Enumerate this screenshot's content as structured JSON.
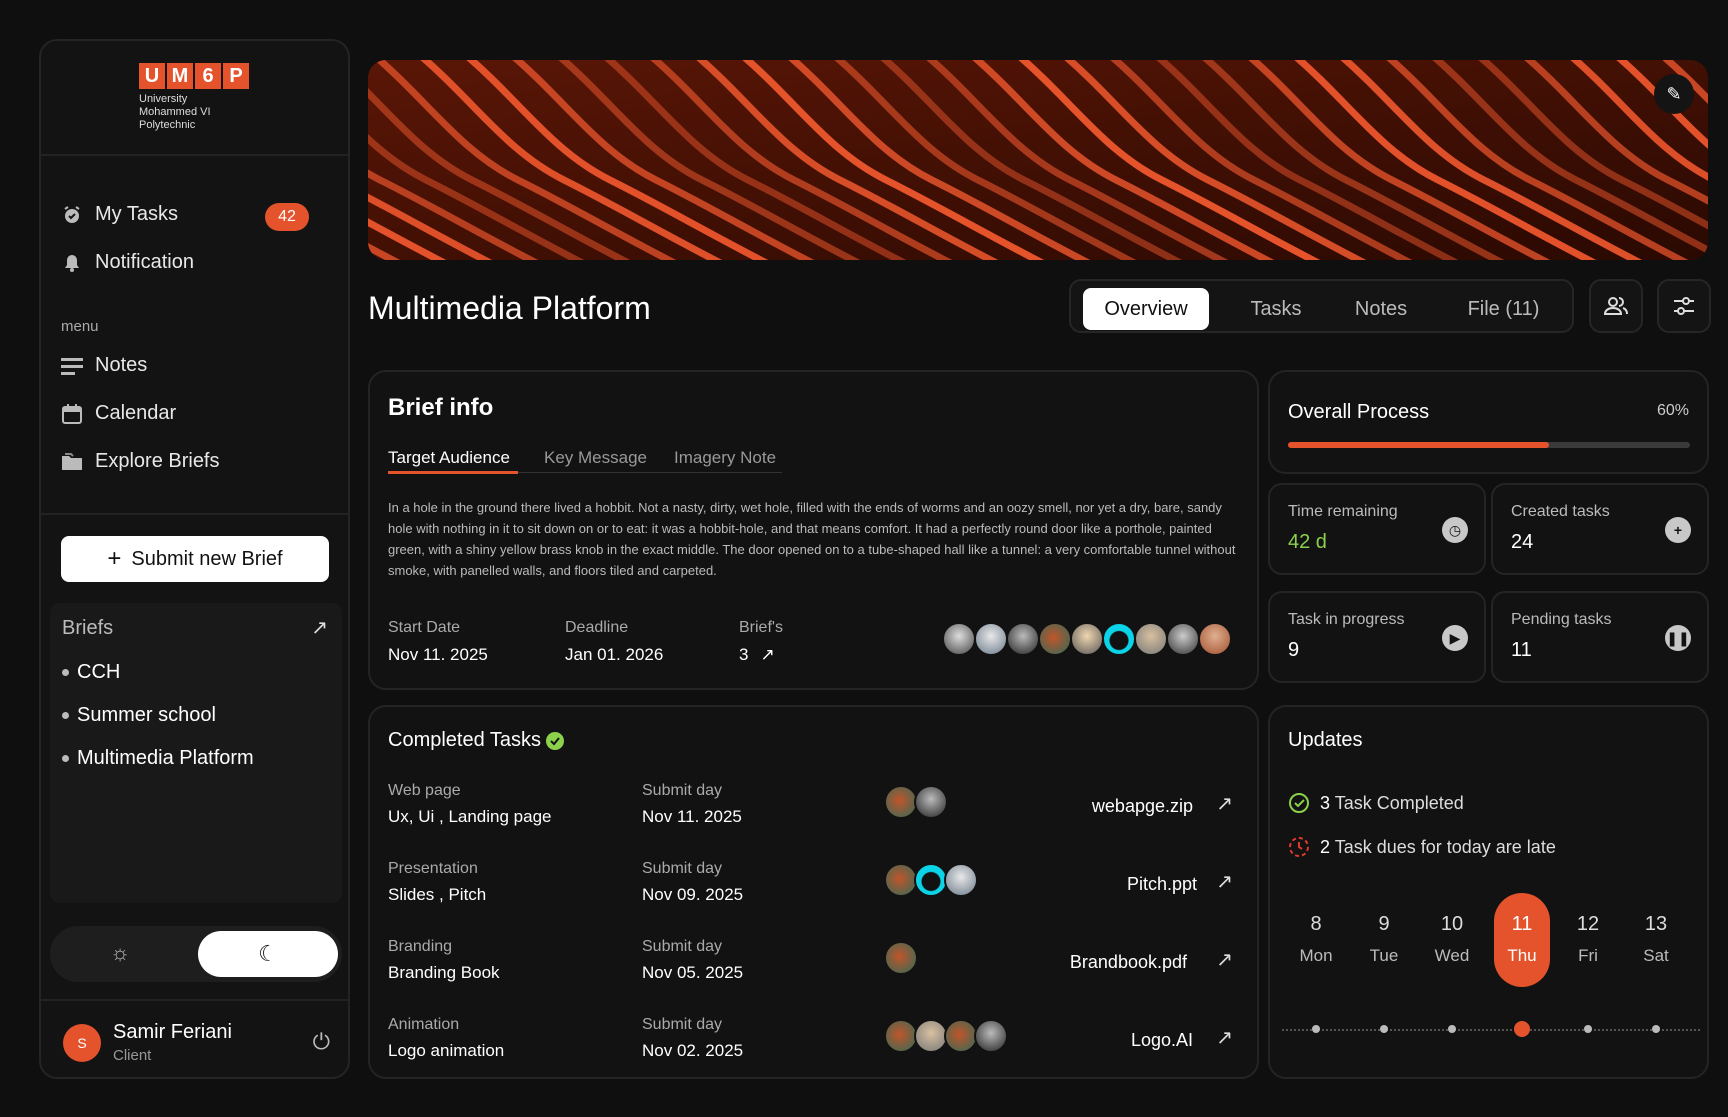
{
  "logo": {
    "letters": [
      "U",
      "M",
      "6",
      "P"
    ],
    "line1": "University",
    "line2": "Mohammed VI",
    "line3": "Polytechnic"
  },
  "sidebar": {
    "my_tasks": "My Tasks",
    "my_tasks_count": "42",
    "notification": "Notification",
    "menu_label": "menu",
    "notes": "Notes",
    "calendar": "Calendar",
    "explore_briefs": "Explore Briefs",
    "submit_btn": "Submit new Brief",
    "briefs_title": "Briefs",
    "briefs": [
      "CCH",
      "Summer school",
      "Multimedia Platform"
    ]
  },
  "user": {
    "initial": "S",
    "name": "Samir Feriani",
    "role": "Client"
  },
  "page": {
    "title": "Multimedia Platform"
  },
  "tabs": [
    "Overview",
    "Tasks",
    "Notes",
    "File (11)"
  ],
  "brief_info": {
    "title": "Brief info",
    "subtabs": [
      "Target Audience",
      "Key Message",
      "Imagery Note"
    ],
    "text": "In a hole in the ground there lived a hobbit. Not a nasty, dirty, wet hole, filled with the  ends of worms and an oozy smell, nor yet a dry, bare, sandy hole with nothing in it to sit down on  or to eat: it was a hobbit-hole, and that means comfort. It had a perfectly round door like a porthole, painted green, with a shiny yellow brass  knob in the exact middle. The door opened on to a tube-shaped hall like a tunnel: a very  comfortable tunnel without smoke, with panelled walls, and floors tiled and carpeted.",
    "start_label": "Start Date",
    "start_value": "Nov 11. 2025",
    "deadline_label": "Deadline",
    "deadline_value": "Jan 01. 2026",
    "briefs_label": "Brief's",
    "briefs_value": "3"
  },
  "overall": {
    "title": "Overall Process",
    "percent_label": "60%",
    "progress": 0.65
  },
  "stats": {
    "time_remaining_label": "Time remaining",
    "time_remaining_value": "42 d",
    "created_label": "Created tasks",
    "created_value": "24",
    "progress_label": "Task in progress",
    "progress_value": "9",
    "pending_label": "Pending tasks",
    "pending_value": "11"
  },
  "completed": {
    "title": "Completed Tasks",
    "submit_label": "Submit day",
    "rows": [
      {
        "category": "Web page",
        "name": "Ux, Ui , Landing page",
        "date": "Nov 11. 2025",
        "file": "webapge.zip"
      },
      {
        "category": "Presentation",
        "name": "Slides , Pitch",
        "date": "Nov 09. 2025",
        "file": "Pitch.ppt"
      },
      {
        "category": "Branding",
        "name": "Branding Book",
        "date": "Nov 05. 2025",
        "file": "Brandbook.pdf"
      },
      {
        "category": "Animation",
        "name": "Logo animation",
        "date": "Nov 02. 2025",
        "file": "Logo.AI"
      }
    ]
  },
  "updates": {
    "title": "Updates",
    "completed_count": "3",
    "completed_text": "Task Completed",
    "late_count": "2",
    "late_text": "Task dues for today are late",
    "days": [
      {
        "num": "8",
        "name": "Mon"
      },
      {
        "num": "9",
        "name": "Tue"
      },
      {
        "num": "10",
        "name": "Wed"
      },
      {
        "num": "11",
        "name": "Thu"
      },
      {
        "num": "12",
        "name": "Fri"
      },
      {
        "num": "13",
        "name": "Sat"
      }
    ]
  },
  "colors": {
    "accent": "#e4532b",
    "success": "#8bd14b",
    "danger": "#e0392b"
  }
}
